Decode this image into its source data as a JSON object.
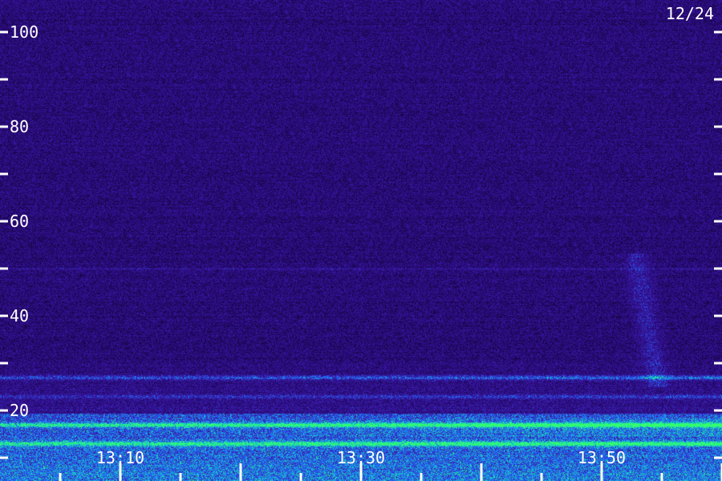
{
  "chart_data": {
    "type": "heatmap",
    "date_label": "12/24",
    "x_tick_labels": [
      "13:10",
      "13:30",
      "13:50"
    ],
    "y_tick_labels": [
      "100",
      "80",
      "60",
      "40",
      "20"
    ],
    "y_ticks_labeled": [
      100,
      80,
      60,
      40,
      20
    ],
    "y_ticks_minor": [
      90,
      70,
      50,
      30,
      10
    ],
    "ylim": [
      10,
      110
    ],
    "xlim_minutes": [
      13.0,
      14.0
    ],
    "x_minor_ticks": [
      "13:05",
      "13:10",
      "13:15",
      "13:20",
      "13:25",
      "13:30",
      "13:35",
      "13:40",
      "13:45",
      "13:50",
      "13:55",
      "14:00"
    ],
    "colormap": {
      "background": "#2a0a7a",
      "low": "#3a1aa8",
      "mid": "#1f6fff",
      "high": "#19e0b0",
      "peak": "#35ff6a"
    },
    "features": {
      "line_at": 50,
      "bands": [
        {
          "level": 27,
          "intensity": "mid"
        },
        {
          "level": 23,
          "intensity": "low"
        },
        {
          "level": 17,
          "intensity": "high"
        },
        {
          "level": 13,
          "intensity": "high"
        }
      ],
      "plume": {
        "time": "13:50",
        "from": 30,
        "to": 50
      }
    }
  }
}
